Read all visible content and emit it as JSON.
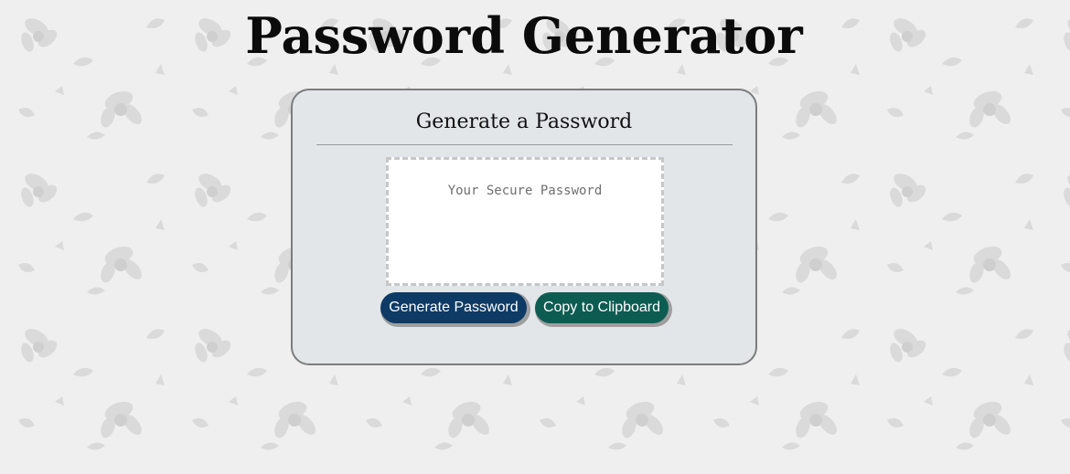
{
  "page": {
    "title": "Password Generator"
  },
  "card": {
    "header": "Generate a Password",
    "password_field": {
      "value": "",
      "placeholder": "Your Secure Password"
    },
    "buttons": {
      "generate_label": "Generate Password",
      "copy_label": "Copy to Clipboard"
    }
  },
  "colors": {
    "generate_button": "#0d3b66",
    "copy_button": "#0d5c52",
    "card_background": "#e2e6e9",
    "page_background": "#efefef"
  },
  "icons": [
    "floral-background-pattern"
  ]
}
